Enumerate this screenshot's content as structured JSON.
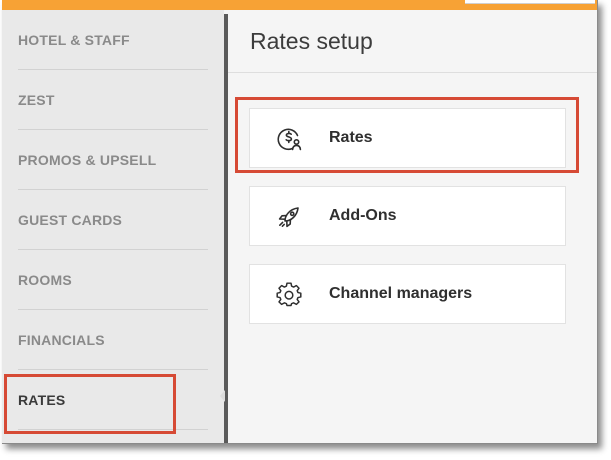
{
  "sidebar": {
    "items": [
      {
        "label": "HOTEL & STAFF"
      },
      {
        "label": "ZEST"
      },
      {
        "label": "PROMOS & UPSELL"
      },
      {
        "label": "GUEST CARDS"
      },
      {
        "label": "ROOMS"
      },
      {
        "label": "FINANCIALS"
      },
      {
        "label": "RATES",
        "active": true
      }
    ]
  },
  "main": {
    "title": "Rates setup",
    "cards": [
      {
        "label": "Rates",
        "icon": "rate-dollar-person-icon"
      },
      {
        "label": "Add-Ons",
        "icon": "rocket-icon"
      },
      {
        "label": "Channel managers",
        "icon": "gear-icon"
      }
    ]
  },
  "colors": {
    "accent_bar": "#f7a235",
    "highlight_box": "#d64a35",
    "sidebar_bg": "#e9e9e9",
    "divider": "#5a5a5a"
  }
}
